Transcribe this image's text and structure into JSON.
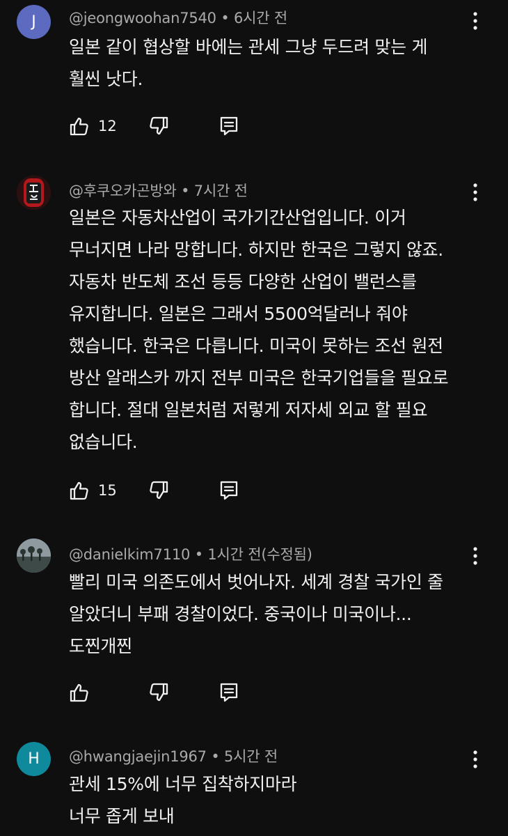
{
  "comments": [
    {
      "avatar_letter": "J",
      "avatar_color": "#5c6bc0",
      "author": "@jeongwoohan7540",
      "time": "6시간 전",
      "lines": [
        "일본 같이 협상할 바에는 관세 그냥 두드려 맞는 게",
        "훨씬 낫다."
      ],
      "likes": "12"
    },
    {
      "avatar_letter": "",
      "avatar_color": "#7a1414",
      "author": "@후쿠오카곤방와",
      "time": "7시간 전",
      "lines": [
        "일본은 자동차산업이 국가기간산업입니다. 이거",
        "무너지면 나라 망합니다. 하지만 한국은 그렇지 않죠.",
        "자동차 반도체 조선 등등 다양한 산업이 밸런스를",
        "유지합니다. 일본은 그래서 5500억달러나 줘야",
        "했습니다. 한국은 다릅니다. 미국이 못하는 조선 원전",
        "방산 알래스카 까지 전부 미국은 한국기업들을 필요로",
        "합니다. 절대 일본처럼 저렇게 저자세 외교 할 필요",
        "없습니다."
      ],
      "likes": "15"
    },
    {
      "avatar_letter": "",
      "avatar_color": "#6f7f86",
      "author": "@danielkim7110",
      "time": "1시간 전(수정됨)",
      "lines": [
        "빨리 미국 의존도에서 벗어나자. 세계 경찰 국가인 줄",
        "알았더니 부패 경찰이었다. 중국이나 미국이나...",
        "도찐개찐"
      ],
      "likes": ""
    },
    {
      "avatar_letter": "H",
      "avatar_color": "#0f8a9d",
      "author": "@hwangjaejin1967",
      "time": "5시간 전",
      "lines": [
        "관세 15%에 너무 집착하지마라",
        "너무 좁게 보내"
      ],
      "likes": ""
    }
  ]
}
